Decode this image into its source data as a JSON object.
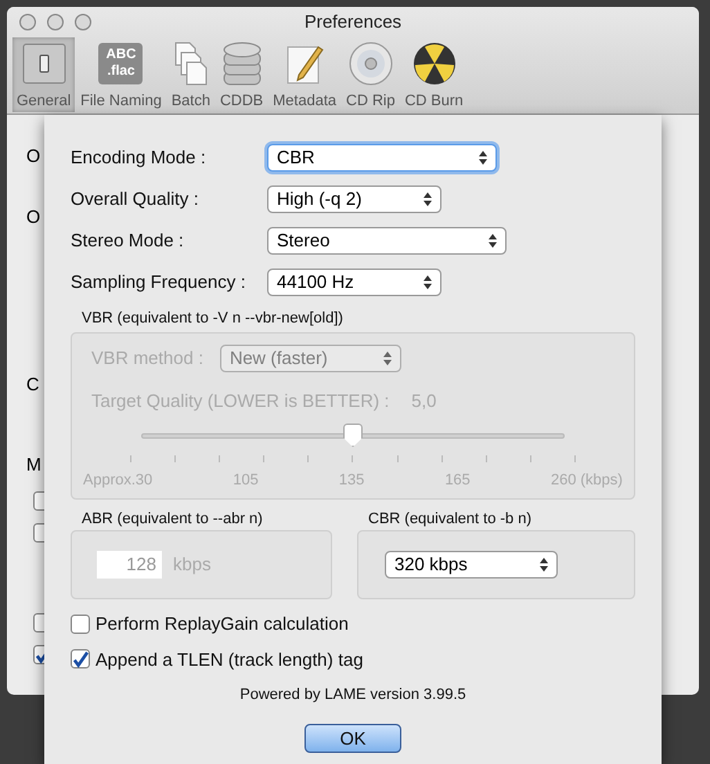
{
  "window": {
    "title": "Preferences"
  },
  "toolbar": [
    {
      "label": "General",
      "kind": "switch",
      "selected": true
    },
    {
      "label": "File Naming",
      "kind": "label-tile",
      "icon_text": [
        "ABC",
        ".flac"
      ],
      "selected": false
    },
    {
      "label": "Batch",
      "kind": "documents",
      "selected": false
    },
    {
      "label": "CDDB",
      "kind": "database",
      "selected": false
    },
    {
      "label": "Metadata",
      "kind": "pencil",
      "selected": false
    },
    {
      "label": "CD Rip",
      "kind": "disc",
      "selected": false
    },
    {
      "label": "CD Burn",
      "kind": "hazard",
      "selected": false
    }
  ],
  "background_labels": [
    "O",
    "O",
    "C",
    "M"
  ],
  "background_checkboxes": [
    {
      "checked": false
    },
    {
      "checked": false
    },
    {
      "checked": false
    },
    {
      "checked": true
    }
  ],
  "sheet": {
    "popups": [
      {
        "label": "Encoding Mode :",
        "value": "CBR",
        "focused": true
      },
      {
        "label": "Overall Quality :",
        "value": "High (-q 2)",
        "focused": false
      },
      {
        "label": "Stereo Mode :",
        "value": "Stereo",
        "focused": false
      },
      {
        "label": "Sampling Frequency :",
        "value": "44100 Hz",
        "focused": false
      }
    ],
    "vbr": {
      "title": "VBR (equivalent to -V n --vbr-new[old])",
      "disabled": true,
      "method_label": "VBR method :",
      "method_value": "New (faster)",
      "target_label": "Target Quality (LOWER is BETTER) :",
      "target_value": "5,0",
      "level": 0.5,
      "tick_labels": [
        "Approx.30",
        "105",
        "135",
        "165",
        "260 (kbps)"
      ]
    },
    "abr": {
      "title": "ABR (equivalent to --abr n)",
      "value": "128",
      "unit": "kbps"
    },
    "cbr": {
      "title": "CBR (equivalent to -b n)",
      "value": "320 kbps"
    },
    "checkboxes": [
      {
        "label": "Perform ReplayGain calculation",
        "checked": false
      },
      {
        "label": "Append a TLEN (track length) tag",
        "checked": true
      }
    ],
    "footer": "Powered by LAME version 3.99.5",
    "ok_button": "OK"
  }
}
